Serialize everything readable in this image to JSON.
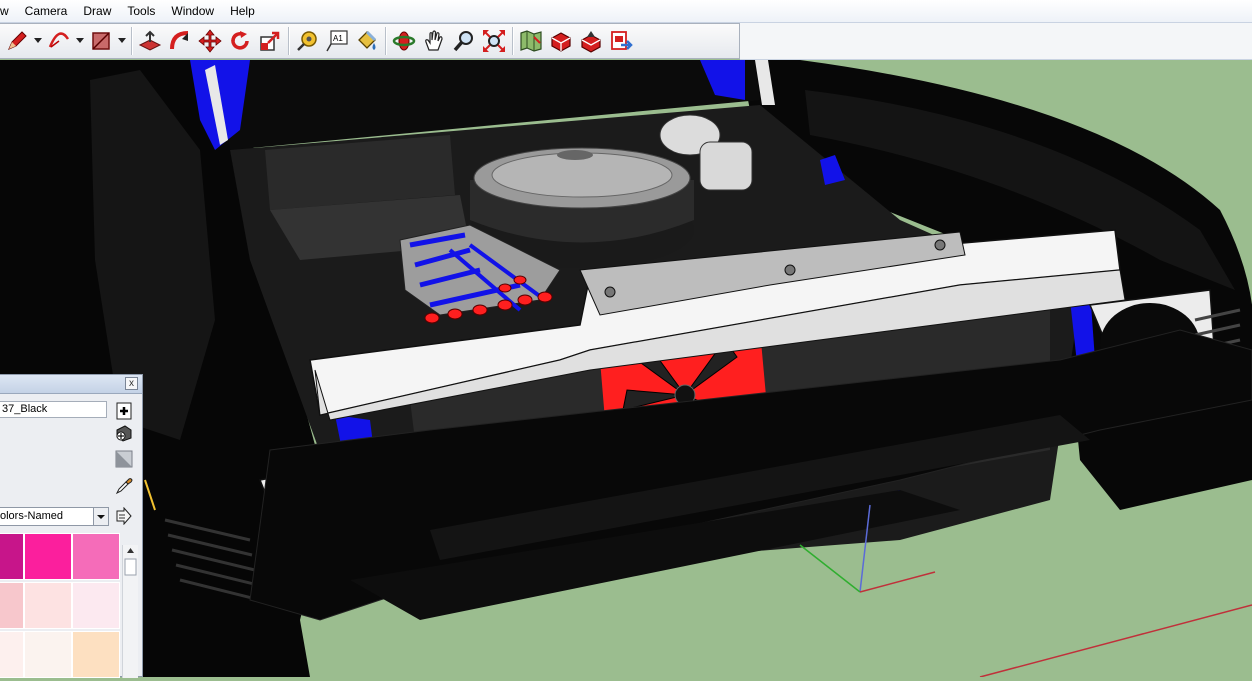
{
  "menu": {
    "items": [
      "w",
      "Camera",
      "Draw",
      "Tools",
      "Window",
      "Help"
    ]
  },
  "toolbar": {
    "tools": [
      {
        "name": "pencil-line-tool",
        "icon": "pencil-icon",
        "dropdown": true
      },
      {
        "name": "arc-tool",
        "icon": "arc-icon",
        "dropdown": true
      },
      {
        "name": "rectangle-tool",
        "icon": "rectangle-icon",
        "dropdown": true
      },
      {
        "name": "push-pull-tool",
        "icon": "push-pull-icon"
      },
      {
        "name": "follow-me-tool",
        "icon": "follow-me-icon"
      },
      {
        "name": "move-tool",
        "icon": "move-icon"
      },
      {
        "name": "rotate-tool",
        "icon": "rotate-icon"
      },
      {
        "name": "scale-tool",
        "icon": "scale-icon"
      },
      {
        "name": "tape-measure-tool",
        "icon": "tape-measure-icon"
      },
      {
        "name": "text-tool",
        "icon": "text-icon",
        "label": "A1"
      },
      {
        "name": "paint-bucket-tool",
        "icon": "paint-bucket-icon"
      },
      {
        "name": "orbit-tool",
        "icon": "orbit-icon"
      },
      {
        "name": "pan-tool",
        "icon": "pan-hand-icon"
      },
      {
        "name": "zoom-tool",
        "icon": "zoom-icon"
      },
      {
        "name": "zoom-extents-tool",
        "icon": "zoom-extents-icon"
      },
      {
        "name": "add-location-tool",
        "icon": "map-location-icon"
      },
      {
        "name": "get-models-tool",
        "icon": "get-models-icon"
      },
      {
        "name": "share-model-tool",
        "icon": "share-model-icon"
      },
      {
        "name": "send-to-layout-tool",
        "icon": "send-to-layout-icon"
      }
    ]
  },
  "materials_panel": {
    "close_label": "x",
    "material_name": "37_Black",
    "library": "olors-Named",
    "icons": [
      "create-material-icon",
      "sample-paint-icon",
      "default-material-icon",
      "eyedropper-icon",
      "details-arrow-icon"
    ],
    "swatches": [
      [
        "#c7158a",
        "#fb1f9d",
        "#f56cb9"
      ],
      [
        "#f7c7cc",
        "#fde2e2",
        "#fce9f0"
      ],
      [
        "#fdf0ee",
        "#fbf3ef",
        "#fde0c1"
      ]
    ]
  },
  "colors": {
    "ground": "#9bbd8f",
    "car_body": "#050505",
    "engine_blue": "#1212e8",
    "engine_red": "#ff1f1f",
    "chrome": "#f2f2f2",
    "axis_red": "#c0303a",
    "axis_green": "#2fae2f",
    "axis_blue": "#5b6bd8"
  }
}
